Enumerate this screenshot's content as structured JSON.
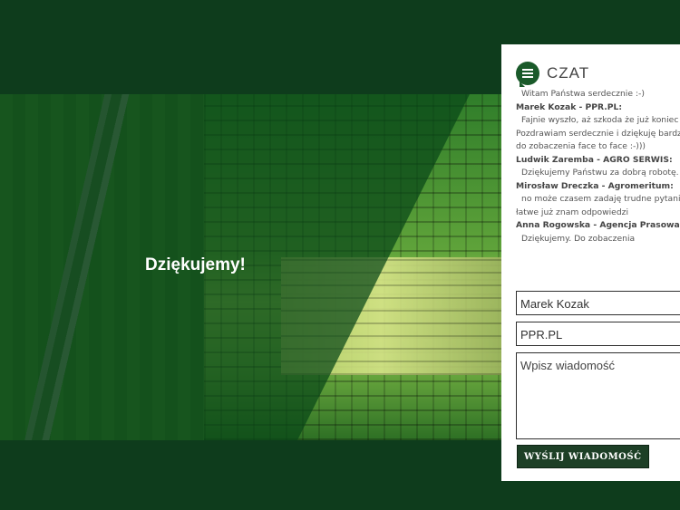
{
  "hero": {
    "title": "Dziękujemy!"
  },
  "chat": {
    "title": "CZAT",
    "messages": [
      {
        "name": "",
        "lines": [
          "Witam Państwa serdecznie :-)"
        ]
      },
      {
        "name": "Marek Kozak - PPR.PL:",
        "lines": [
          "Fajnie wyszło, aż szkoda że już koniec",
          "Pozdrawiam serdecznie i dziękuję bardzo",
          "do zobaczenia face to face :-)))"
        ]
      },
      {
        "name": "Ludwik Zaremba - AGRO SERWIS:",
        "lines": [
          "Dziękujemy Państwu za dobrą robotę."
        ]
      },
      {
        "name": "Mirosław Dreczka - Agromeritum:",
        "lines": [
          "no może czasem zadaję trudne pytania",
          "łatwe już znam odpowiedzi"
        ]
      },
      {
        "name": "Anna Rogowska - Agencja Prasowa",
        "lines": [
          "Dziękujemy. Do zobaczenia"
        ]
      }
    ],
    "form": {
      "name_value": "Marek Kozak",
      "company_value": "PPR.PL",
      "message_placeholder": "Wpisz wiadomość",
      "send_label": "WYŚLIJ WIADOMOŚĆ"
    }
  }
}
